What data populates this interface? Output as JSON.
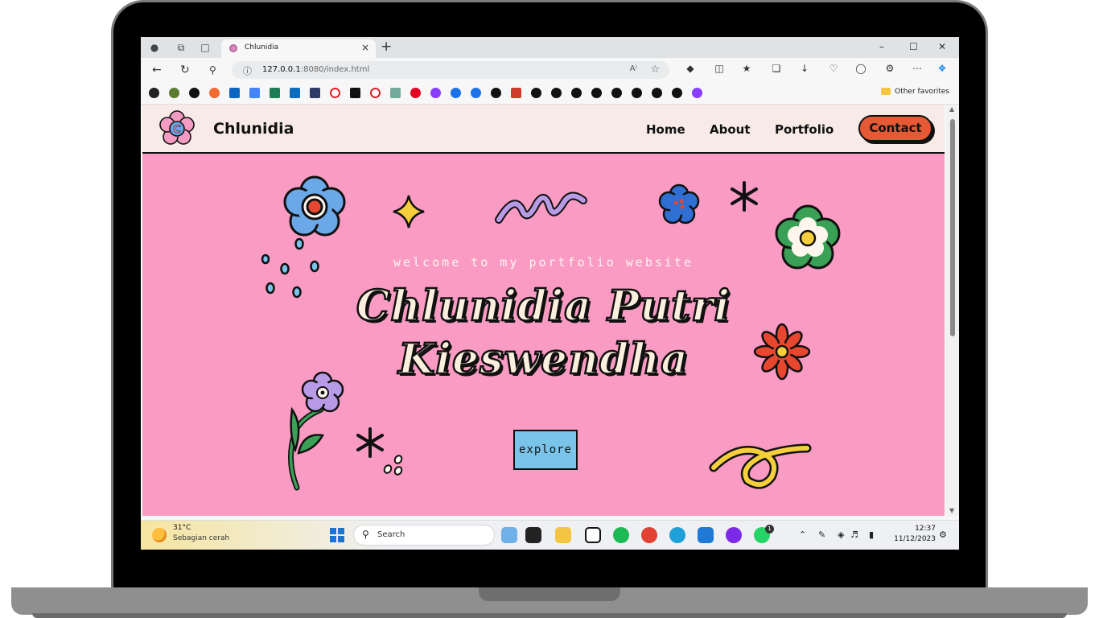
{
  "browser": {
    "tab_title": "Chlunidia",
    "tab_close": "×",
    "new_tab": "+",
    "url_host": "127.0.0.1",
    "url_rest": ":8080/index.html",
    "read_aloud": "A⁾",
    "other_favorites": "Other favorites",
    "window_controls": [
      "–",
      "☐",
      "✕"
    ]
  },
  "site": {
    "brand": "Chlunidia",
    "nav": [
      "Home",
      "About",
      "Portfolio"
    ],
    "contact": "Contact",
    "welcome": "welcome to my portfolio website",
    "name_line1": "Chlunidia Putri",
    "name_line2": "Kieswendha",
    "explore": "explore",
    "colors": {
      "page_bg": "#f99bc2",
      "nav_bg": "#f8ebe7",
      "contact_bg": "#e55a35",
      "explore_bg": "#79c4e8",
      "name_fill": "#fbf0de"
    }
  },
  "taskbar": {
    "temperature": "31°C",
    "condition": "Sebagian cerah",
    "search": "Search",
    "time": "12:37",
    "date": "11/12/2023",
    "whatsapp_badge": "1"
  }
}
